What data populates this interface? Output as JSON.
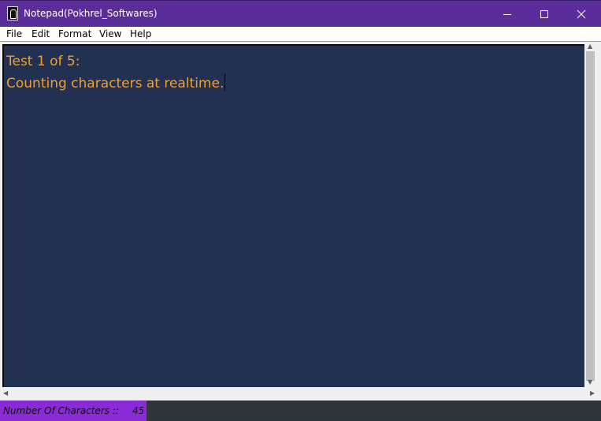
{
  "window": {
    "title": "Notepad(Pokhrel_Softwares)",
    "minimize_icon": "minimize-icon",
    "maximize_icon": "maximize-icon",
    "close_icon": "close-icon"
  },
  "menu": {
    "items": [
      {
        "label": "File"
      },
      {
        "label": "Edit"
      },
      {
        "label": "Format"
      },
      {
        "label": "View"
      },
      {
        "label": "Help"
      }
    ]
  },
  "editor": {
    "lines": [
      "Test 1 of 5:",
      "Counting characters at realtime."
    ],
    "background": "#223051",
    "text_color": "#f0a030"
  },
  "status": {
    "label": "Number Of Characters ::",
    "count": "45",
    "accent": "#8a2bd8"
  }
}
